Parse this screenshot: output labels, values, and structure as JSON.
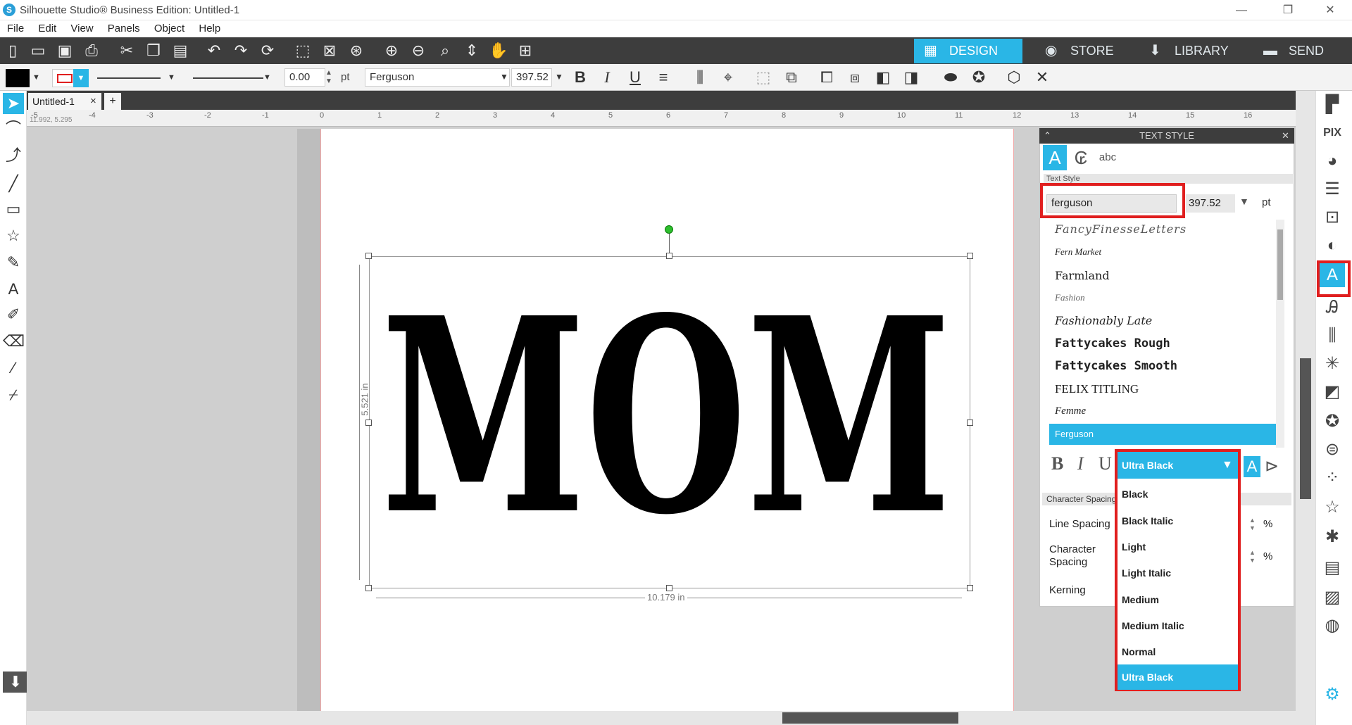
{
  "window": {
    "title": "Silhouette Studio® Business Edition: Untitled-1",
    "minimize": "—",
    "restore": "❐",
    "close": "✕"
  },
  "menu": [
    "File",
    "Edit",
    "View",
    "Panels",
    "Object",
    "Help"
  ],
  "nav_tabs": {
    "design": "DESIGN",
    "store": "STORE",
    "library": "LIBRARY",
    "send": "SEND"
  },
  "toolbar2": {
    "line_width": "0.00",
    "line_unit": "pt",
    "font_name": "Ferguson",
    "font_size": "397.52"
  },
  "doc_tab": {
    "label": "Untitled-1",
    "close": "×",
    "add": "+"
  },
  "ruler": {
    "coords": "11.992, 5.295",
    "ticks": [
      "-5",
      "-4",
      "-3",
      "-2",
      "-1",
      "0",
      "1",
      "2",
      "3",
      "4",
      "5",
      "6",
      "7",
      "8",
      "9",
      "10",
      "11",
      "12",
      "13",
      "14",
      "15",
      "16"
    ]
  },
  "canvas": {
    "text": "MOM",
    "width_label": "10.179 in",
    "height_label": "5.521 in"
  },
  "panel": {
    "title": "TEXT STYLE",
    "section_label": "Text Style",
    "font_search": "ferguson",
    "size": "397.52",
    "size_unit": "pt",
    "fonts": [
      "FancyFinesseLetters",
      "Fern Market",
      "Farmland",
      "Fashion",
      "Fashionably Late",
      "Fattycakes Rough",
      "Fattycakes Smooth",
      "FELIX TITLING",
      "Femme",
      "Ferguson"
    ],
    "selected_font": "Ferguson",
    "char_spacing_header": "Character Spacing",
    "line_spacing": "Line Spacing",
    "character_spacing": "Character Spacing",
    "kerning": "Kerning",
    "percent": "%"
  },
  "weight_dropdown": {
    "selected": "Ultra Black",
    "options": [
      "Black",
      "Black Italic",
      "Light",
      "Light Italic",
      "Medium",
      "Medium Italic",
      "Normal",
      "Ultra Black"
    ]
  },
  "colors": {
    "accent": "#2ab6e6",
    "highlight": "#e01f1f",
    "toolbar": "#3d3d3d"
  }
}
